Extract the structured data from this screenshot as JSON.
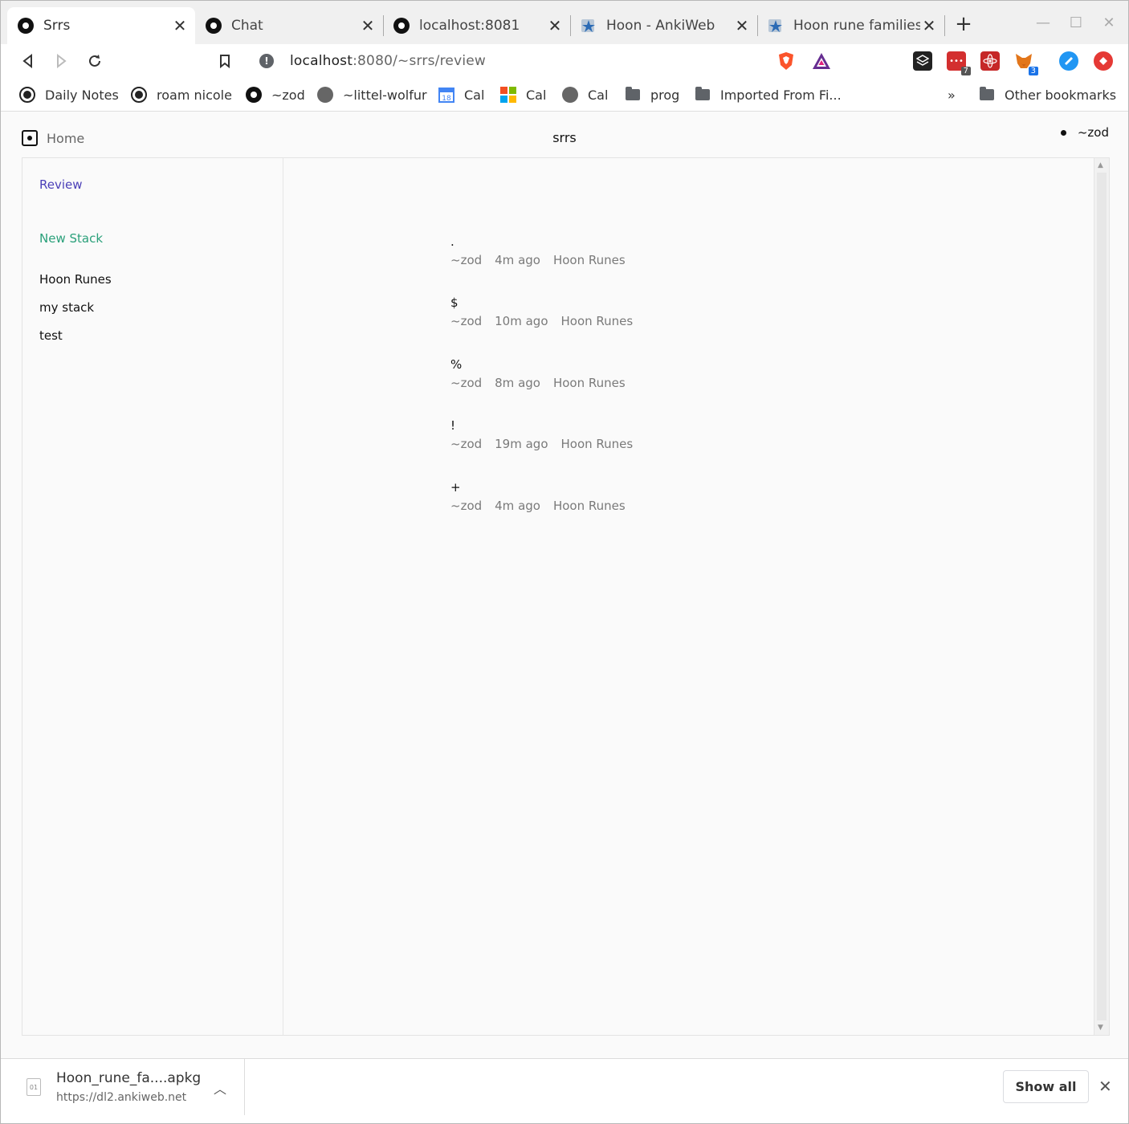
{
  "tabs": [
    {
      "title": "Srrs",
      "icon": "urbit-icon",
      "active": true
    },
    {
      "title": "Chat",
      "icon": "urbit-icon",
      "active": false
    },
    {
      "title": "localhost:8081",
      "icon": "urbit-icon",
      "active": false
    },
    {
      "title": "Hoon - AnkiWeb",
      "icon": "anki-icon",
      "active": false
    },
    {
      "title": "Hoon rune families -",
      "icon": "anki-icon",
      "active": false
    }
  ],
  "window_controls": {
    "minimize": "—",
    "maximize": "☐",
    "close": "✕"
  },
  "address_bar": {
    "host": "localhost",
    "rest": ":8080/~srrs/review"
  },
  "bookmarks": [
    {
      "label": "Daily Notes",
      "icon": "roam-icon"
    },
    {
      "label": "roam nicole",
      "icon": "roam-icon"
    },
    {
      "label": "~zod",
      "icon": "urbit-icon"
    },
    {
      "label": "~littel-wolfur",
      "icon": "globe-icon"
    },
    {
      "label": "Cal",
      "icon": "google-calendar-icon"
    },
    {
      "label": "Cal",
      "icon": "microsoft-icon"
    },
    {
      "label": "Cal",
      "icon": "globe-icon"
    },
    {
      "label": "prog",
      "icon": "folder-icon"
    },
    {
      "label": "Imported From Fi...",
      "icon": "folder-icon"
    }
  ],
  "bookmarks_overflow": "»",
  "other_bookmarks": "Other bookmarks",
  "extensions": {
    "badge_1": "7",
    "badge_2": "3"
  },
  "app": {
    "home_label": "Home",
    "title": "srrs",
    "ship": "~zod"
  },
  "sidebar": {
    "review": "Review",
    "new_stack": "New Stack",
    "stacks": [
      "Hoon Runes",
      "my stack",
      "test"
    ]
  },
  "review_items": [
    {
      "rune": ".",
      "author": "~zod",
      "age": "4m ago",
      "stack": "Hoon Runes"
    },
    {
      "rune": "$",
      "author": "~zod",
      "age": "10m ago",
      "stack": "Hoon Runes"
    },
    {
      "rune": "%",
      "author": "~zod",
      "age": "8m ago",
      "stack": "Hoon Runes"
    },
    {
      "rune": "!",
      "author": "~zod",
      "age": "19m ago",
      "stack": "Hoon Runes"
    },
    {
      "rune": "+",
      "author": "~zod",
      "age": "4m ago",
      "stack": "Hoon Runes"
    }
  ],
  "download": {
    "filename": "Hoon_rune_fa....apkg",
    "source": "https://dl2.ankiweb.net",
    "show_all": "Show all"
  },
  "colors": {
    "review_link": "#4b3fb8",
    "new_stack_link": "#2aa07a",
    "meta_text": "#7a7a7a"
  }
}
